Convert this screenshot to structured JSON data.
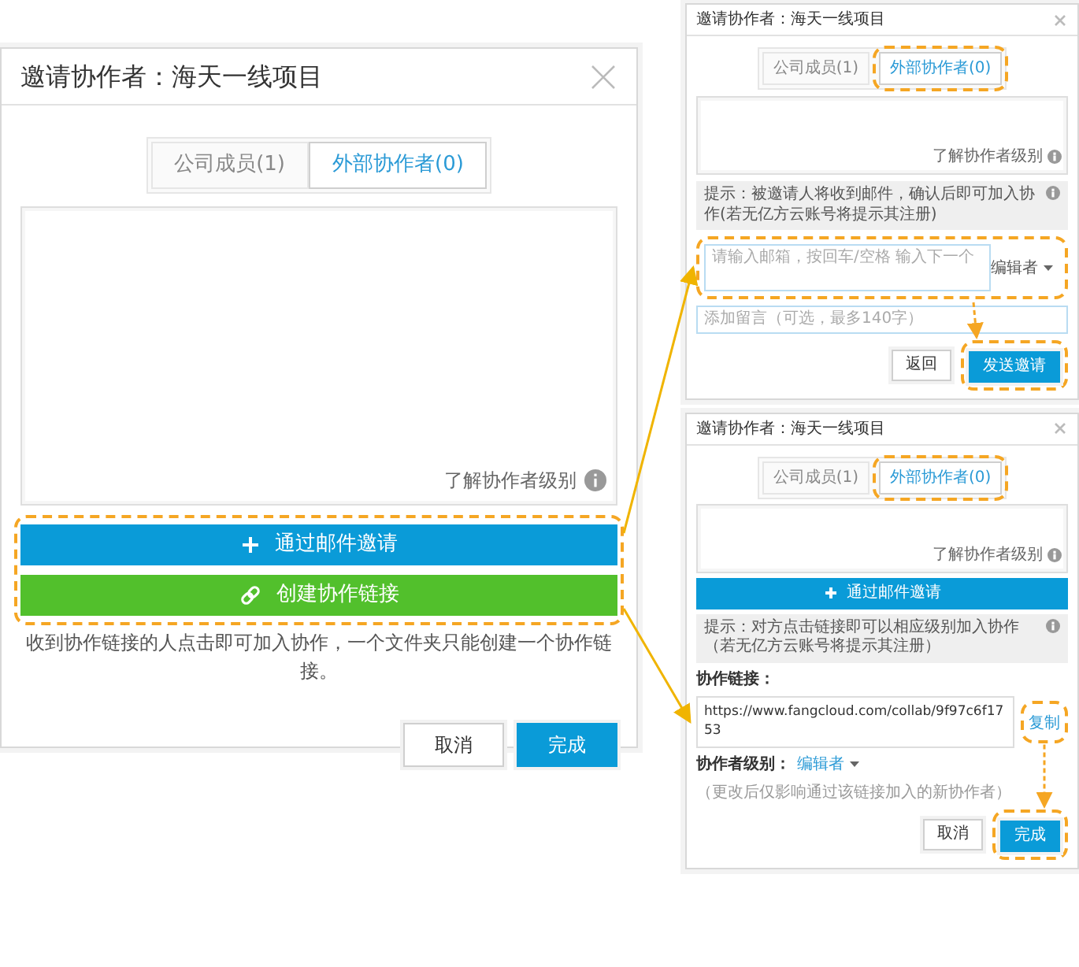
{
  "main_dialog": {
    "title": "邀请协作者：海天一线项目",
    "tabs": [
      {
        "label": "公司成员(1)",
        "selected": false
      },
      {
        "label": "外部协作者(0)",
        "selected": true
      }
    ],
    "learn_link": "了解协作者级别",
    "invite_buttons": [
      {
        "kind": "email",
        "label": "通过邮件邀请"
      },
      {
        "kind": "link",
        "label": "创建协作链接"
      }
    ],
    "note": "收到协作链接的人点击即可加入协作，一个文件夹只能创建一个协作链接。",
    "footer_buttons": [
      {
        "label": "取消",
        "kind": "secondary"
      },
      {
        "label": "完成",
        "kind": "primary"
      }
    ]
  },
  "email_dialog": {
    "title": "邀请协作者：海天一线项目",
    "tabs": [
      {
        "label": "公司成员(1)",
        "selected": false
      },
      {
        "label": "外部协作者(0)",
        "selected": true
      }
    ],
    "learn_link": "了解协作者级别",
    "tip": "提示：被邀请人将收到邮件，确认后即可加入协作(若无亿方云账号将提示其注册)",
    "email_field": {
      "placeholder": "请输入邮箱，按回车/空格 输入下一个",
      "role": "编辑者"
    },
    "message_field": {
      "placeholder": "添加留言（可选，最多140字）"
    },
    "footer_buttons": [
      {
        "label": "返回",
        "kind": "secondary"
      },
      {
        "label": "发送邀请",
        "kind": "primary"
      }
    ]
  },
  "link_dialog": {
    "title": "邀请协作者：海天一线项目",
    "tabs": [
      {
        "label": "公司成员(1)",
        "selected": false
      },
      {
        "label": "外部协作者(0)",
        "selected": true
      }
    ],
    "learn_link": "了解协作者级别",
    "invite_button": "通过邮件邀请",
    "tip": "提示：对方点击链接即可以相应级别加入协作（若无亿方云账号将提示其注册）",
    "link_label": "协作链接：",
    "link_value": "https://www.fangcloud.com/collab/9f97c6f1753",
    "copy_link": "复制",
    "level_label": "协作者级别：",
    "level_value": "编辑者",
    "level_note": "（更改后仅影响通过该链接加入的新协作者）",
    "footer_buttons": [
      {
        "label": "取消",
        "kind": "secondary"
      },
      {
        "label": "完成",
        "kind": "primary"
      }
    ]
  }
}
